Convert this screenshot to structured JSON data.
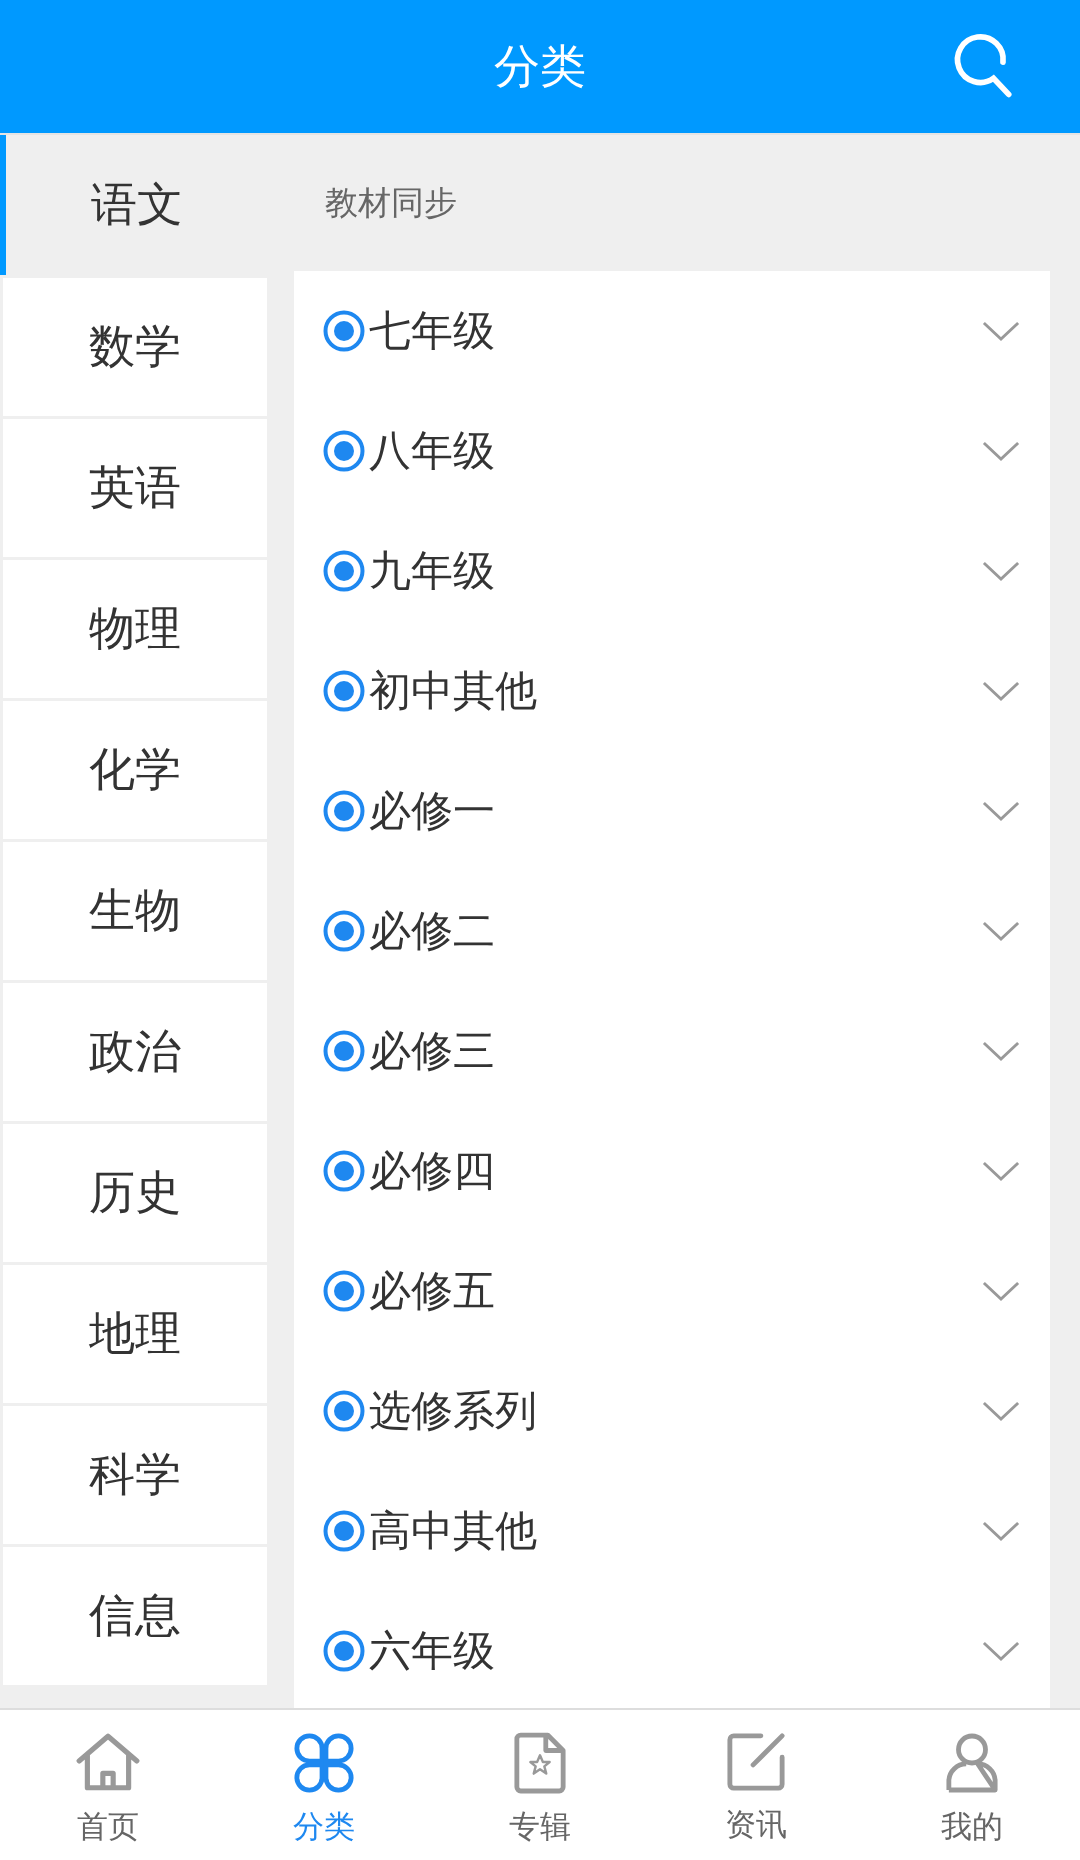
{
  "header": {
    "title": "分类"
  },
  "sidebar": {
    "items": [
      {
        "label": "语文",
        "selected": true
      },
      {
        "label": "数学",
        "selected": false
      },
      {
        "label": "英语",
        "selected": false
      },
      {
        "label": "物理",
        "selected": false
      },
      {
        "label": "化学",
        "selected": false
      },
      {
        "label": "生物",
        "selected": false
      },
      {
        "label": "政治",
        "selected": false
      },
      {
        "label": "历史",
        "selected": false
      },
      {
        "label": "地理",
        "selected": false
      },
      {
        "label": "科学",
        "selected": false
      },
      {
        "label": "信息",
        "selected": false
      }
    ]
  },
  "content": {
    "section_title": "教材同步",
    "items": [
      {
        "label": "七年级",
        "selected": true
      },
      {
        "label": "八年级",
        "selected": true
      },
      {
        "label": "九年级",
        "selected": true
      },
      {
        "label": "初中其他",
        "selected": true
      },
      {
        "label": "必修一",
        "selected": true
      },
      {
        "label": "必修二",
        "selected": true
      },
      {
        "label": "必修三",
        "selected": true
      },
      {
        "label": "必修四",
        "selected": true
      },
      {
        "label": "必修五",
        "selected": true
      },
      {
        "label": "选修系列",
        "selected": true
      },
      {
        "label": "高中其他",
        "selected": true
      },
      {
        "label": "六年级",
        "selected": true
      }
    ]
  },
  "tab_bar": [
    {
      "kind": "home",
      "label": "首页",
      "selected": false
    },
    {
      "kind": "category",
      "label": "分类",
      "selected": true
    },
    {
      "kind": "album",
      "label": "专辑",
      "selected": false
    },
    {
      "kind": "news",
      "label": "资讯",
      "selected": false
    },
    {
      "kind": "profile",
      "label": "我的",
      "selected": false
    }
  ]
}
